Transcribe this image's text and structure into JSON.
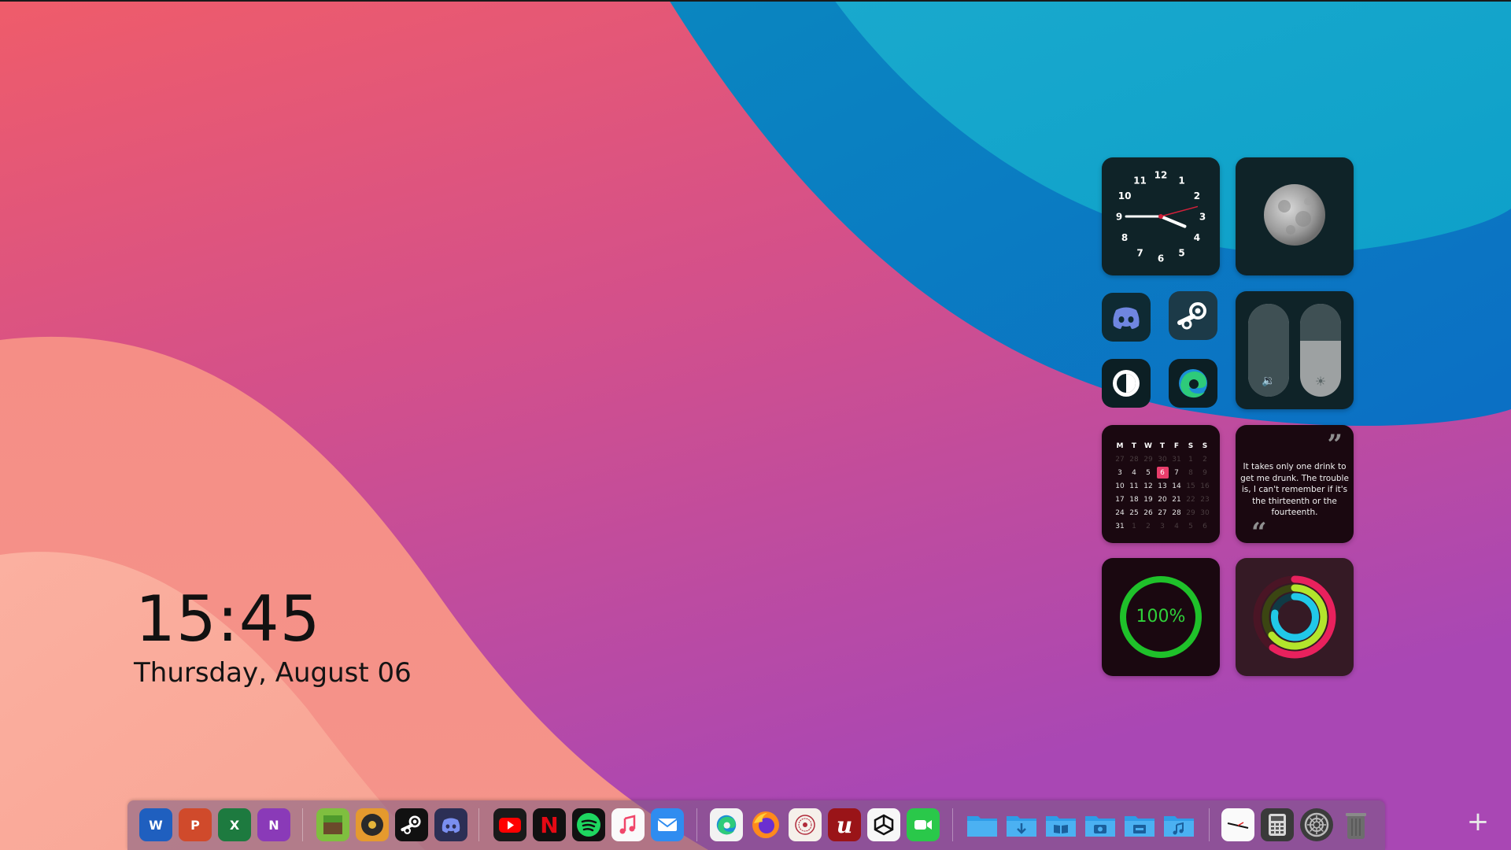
{
  "clock": {
    "time": "15:45",
    "date": "Thursday, August 06"
  },
  "analog_clock": {
    "numbers": [
      "12",
      "1",
      "2",
      "3",
      "4",
      "5",
      "6",
      "7",
      "8",
      "9",
      "10",
      "11"
    ],
    "hour": 3,
    "minute": 45
  },
  "controls": {
    "volume_icon": "speaker-icon",
    "brightness_icon": "sun-icon",
    "volume_level": 0,
    "brightness_level": 0.6
  },
  "calendar": {
    "weekday_headers": [
      "M",
      "T",
      "W",
      "T",
      "F",
      "S",
      "S"
    ],
    "weeks": [
      [
        "27",
        "28",
        "29",
        "30",
        "31",
        "1",
        "2"
      ],
      [
        "3",
        "4",
        "5",
        "6",
        "7",
        "8",
        "9"
      ],
      [
        "10",
        "11",
        "12",
        "13",
        "14",
        "15",
        "16"
      ],
      [
        "17",
        "18",
        "19",
        "20",
        "21",
        "22",
        "23"
      ],
      [
        "24",
        "25",
        "26",
        "27",
        "28",
        "29",
        "30"
      ],
      [
        "31",
        "1",
        "2",
        "3",
        "4",
        "5",
        "6"
      ]
    ],
    "today": "6"
  },
  "quote": {
    "text": "It takes only one drink to get me drunk. The trouble is, I can't remember if it's the thirteenth or the fourteenth.",
    "open_mark": "“",
    "close_mark": "”"
  },
  "battery": {
    "label": "100%",
    "level": 1.0,
    "color": "#1fc12a"
  },
  "activity": {
    "rings": [
      "#e8215d",
      "#b3e52c",
      "#21c8e8"
    ]
  },
  "shortcuts": [
    "discord-icon",
    "steam-icon",
    "contrast-icon",
    "edge-icon"
  ],
  "dock": {
    "groups": [
      [
        "word-icon",
        "powerpoint-icon",
        "excel-icon",
        "onenote-icon"
      ],
      [
        "minecraft-icon",
        "music-disc-icon",
        "steam-icon",
        "discord-icon"
      ],
      [
        "youtube-icon",
        "netflix-icon",
        "spotify-icon",
        "itunes-icon",
        "mail-icon"
      ],
      [
        "edge-icon",
        "firefox-icon",
        "seal-app-icon",
        "acrobat-icon",
        "unity-icon",
        "facetime-icon"
      ],
      [
        "folder-icon",
        "downloads-folder-icon",
        "documents-folder-icon",
        "pictures-folder-icon",
        "drive-folder-icon",
        "music-folder-icon"
      ],
      [
        "clock-app-icon",
        "calculator-icon",
        "settings-icon",
        "trash-icon"
      ]
    ],
    "letters": {
      "word": "W",
      "powerpoint": "P",
      "excel": "X",
      "onenote": "N",
      "netflix": "N",
      "acrobat": "u"
    }
  },
  "add_button": "+",
  "colors": {
    "wallpaper_red": "#ee5a6a",
    "wallpaper_purple": "#b046b0",
    "wallpaper_blue": "#1fa6c9",
    "wallpaper_peach": "#f7a28f",
    "accent_today": "#e83d6b"
  }
}
